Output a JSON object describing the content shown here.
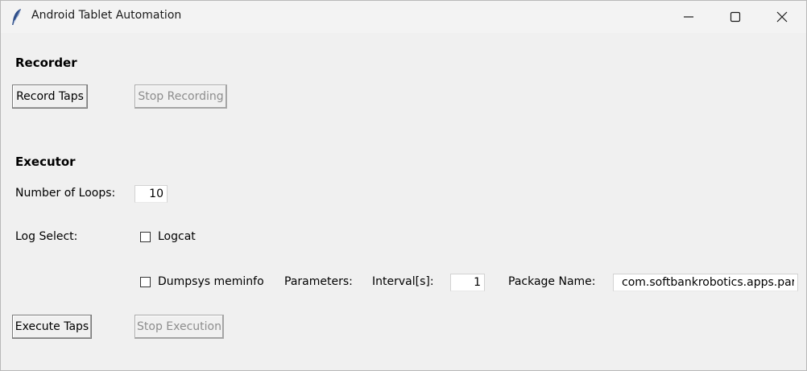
{
  "window": {
    "title": "Android Tablet Automation"
  },
  "recorder": {
    "heading": "Recorder",
    "record_label": "Record Taps",
    "stop_label": "Stop Recording"
  },
  "executor": {
    "heading": "Executor",
    "loops_label": "Number of Loops:",
    "loops_value": "10",
    "log_select_label": "Log Select:",
    "logcat_label": "Logcat",
    "logcat_checked": false,
    "dumpsys_label": "Dumpsys meminfo",
    "dumpsys_checked": false,
    "parameters_label": "Parameters:",
    "interval_label": "Interval[s]:",
    "interval_value": "1",
    "package_label": "Package Name:",
    "package_value": "com.softbankrobotics.apps.party",
    "execute_label": "Execute Taps",
    "stop_label": "Stop Execution"
  },
  "icons": {
    "app": "feather-icon",
    "minimize": "minimize-icon",
    "maximize": "maximize-icon",
    "close": "close-icon"
  }
}
